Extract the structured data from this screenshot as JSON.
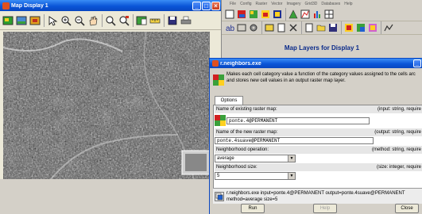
{
  "map_display": {
    "title": "Map Display 1",
    "toolbar_icons": [
      "display-icon",
      "redraw-icon",
      "erase-icon",
      "pointer-icon",
      "zoom-in-icon",
      "zoom-out-icon",
      "pan-icon",
      "zoom-back-icon",
      "zoom-menu-icon",
      "query-icon",
      "measure-icon",
      "save-icon",
      "print-icon"
    ]
  },
  "gis_manager": {
    "menu": [
      "File",
      "Config",
      "Raster",
      "Vector",
      "Imagery",
      "Grid3D",
      "Databases",
      "Help"
    ],
    "map_layers_title": "Map Layers for Display 1"
  },
  "dialog": {
    "title": "r.neighbors.exe",
    "description_line1": "Makes each cell category value a function of the category values assigned to the cells arc",
    "description_line2": "and stores new cell values in an output raster map layer.",
    "tab_options": "Options",
    "field1_label": "Name of existing raster map:",
    "field1_hint": "(input: string, require",
    "field1_value": "ponte.4@PERMANENT",
    "field2_label": "Name of the new raster map:",
    "field2_hint": "(output: string, require",
    "field2_value": "ponte.4suave@PERMANENT",
    "field3_label": "Neighborhood operation:",
    "field3_hint": "(method: string, require",
    "field3_value": "average",
    "field4_label": "Neighborhood size:",
    "field4_hint": "(size: integer, require",
    "field4_value": "5",
    "command_line1": "r.neighbors.exe input=ponte.4@PERMANENT output=ponte.4suave@PERMANENT",
    "command_line2": "method=average size=5",
    "run_button": "Run",
    "help_button": "Help",
    "close_button": "Close"
  },
  "colors": {
    "title_bar": "#0a55d8",
    "map_layers_title": "#0a2a8a"
  }
}
